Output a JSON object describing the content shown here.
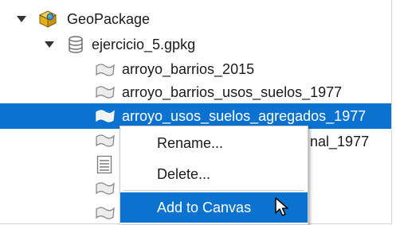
{
  "tree": {
    "root": {
      "label": "GeoPackage",
      "icon": "geopackage-icon"
    },
    "file": {
      "label": "ejercicio_5.gpkg",
      "icon": "database-icon"
    },
    "layers": [
      {
        "label": "arroyo_barrios_2015",
        "icon": "polygon-layer-icon"
      },
      {
        "label": "arroyo_barrios_usos_suelos_1977",
        "icon": "polygon-layer-icon"
      },
      {
        "label": "arroyo_usos_suelos_agregados_1977",
        "icon": "polygon-layer-icon",
        "selected": true
      },
      {
        "label": "nal_1977",
        "icon": "polygon-layer-icon"
      },
      {
        "label": "",
        "icon": "table-icon"
      },
      {
        "label": "",
        "icon": "polygon-layer-icon"
      },
      {
        "label": "",
        "icon": "polygon-layer-icon"
      }
    ]
  },
  "context_menu": {
    "items": [
      {
        "label": "Rename..."
      },
      {
        "label": "Delete..."
      },
      {
        "label": "Add to Canvas",
        "highlighted": true
      }
    ]
  },
  "colors": {
    "selection": "#0b72d0",
    "geopackage_yellow": "#f3c21b"
  }
}
